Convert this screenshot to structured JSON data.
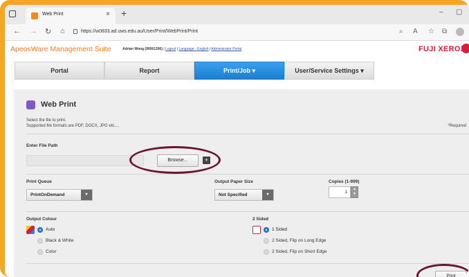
{
  "browser": {
    "tab_title": "Web Print",
    "tab_close": "×",
    "new_tab": "+",
    "url": "https://w0833.ad.uws.edu.au/User/Print/WebPrint/Print",
    "minimize": "–",
    "restore": "▢"
  },
  "header": {
    "brand": "ApeosWare Management Suite",
    "user": "Adrian Wong (90061206)",
    "logout": "Logout",
    "language": "Language - English",
    "admin_portal": "Administrator Portal",
    "sep": "|",
    "vendor": "FUJI XEROX"
  },
  "nav": {
    "tabs": [
      {
        "label": "Portal"
      },
      {
        "label": "Report"
      },
      {
        "label": "Print/Job ▾"
      },
      {
        "label": "User/Service Settings ▾"
      }
    ]
  },
  "page": {
    "title": "Web Print",
    "desc1": "Select the file to print.",
    "desc2": "Supported file formats are PDF, DOCX, JPG etc....",
    "required_note": "*Required"
  },
  "file": {
    "label": "Enter File Path",
    "value": "",
    "browse_label": "Browse...",
    "add_label": "+"
  },
  "print_queue": {
    "label": "Print Queue",
    "selected": "PrintOnDemand"
  },
  "paper_size": {
    "label": "Output Paper Size",
    "selected": "Not Specified"
  },
  "copies": {
    "label": "Copies (1-999)",
    "value": "1"
  },
  "output_colour": {
    "label": "Output Colour",
    "options": [
      "Auto",
      "Black & White",
      "Color"
    ],
    "selected": "Auto"
  },
  "two_sided": {
    "label": "2 Sided",
    "options": [
      "1 Sided",
      "2 Sided, Flip on Long Edge",
      "2 Sided, Flip on Short Edge"
    ],
    "selected": "1 Sided"
  },
  "actions": {
    "print_label": "Print"
  },
  "colors": {
    "frame": "#f5a623",
    "active_tab": "#1b7fd1",
    "annotation_oval": "#6a1631",
    "brand": "#ff7a1a",
    "vendor": "#d4203c"
  }
}
